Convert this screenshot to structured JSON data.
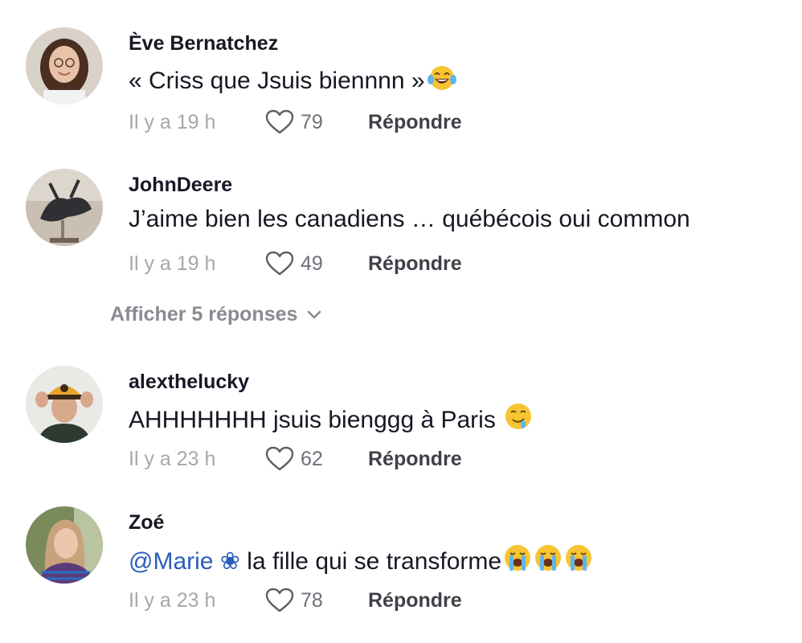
{
  "colors": {
    "text": "#161823",
    "meta": "#a5a7ae",
    "reply": "#404148",
    "mention": "#2b5db9"
  },
  "comments": [
    {
      "username": "Ève Bernatchez",
      "text": "« Criss que Jsuis biennnn »",
      "emojis": [
        "tears-of-joy-emoji"
      ],
      "time": "Il y a 19 h",
      "likes": "79",
      "reply_label": "Répondre"
    },
    {
      "username": "JohnDeere",
      "text": "J’aime bien les canadiens … québécois oui common",
      "emojis": [],
      "time": "Il y a 19 h",
      "likes": "49",
      "reply_label": "Répondre"
    },
    {
      "username": "alexthelucky",
      "text": "AHHHHHHH jsuis bienggg à Paris ",
      "emojis": [
        "drooling-face-emoji"
      ],
      "time": "Il y a 23 h",
      "likes": "62",
      "reply_label": "Répondre"
    },
    {
      "username": "Zoé",
      "mention": "@Marie",
      "mention_suffix": " ❀ ",
      "text": "la fille qui se transforme",
      "emojis": [
        "loudly-crying-emoji",
        "loudly-crying-emoji",
        "loudly-crying-emoji"
      ],
      "time": "Il y a 23 h",
      "likes": "78",
      "reply_label": "Répondre"
    }
  ],
  "show_replies": {
    "label": "Afficher 5 réponses",
    "icon": "chevron-down-icon"
  }
}
